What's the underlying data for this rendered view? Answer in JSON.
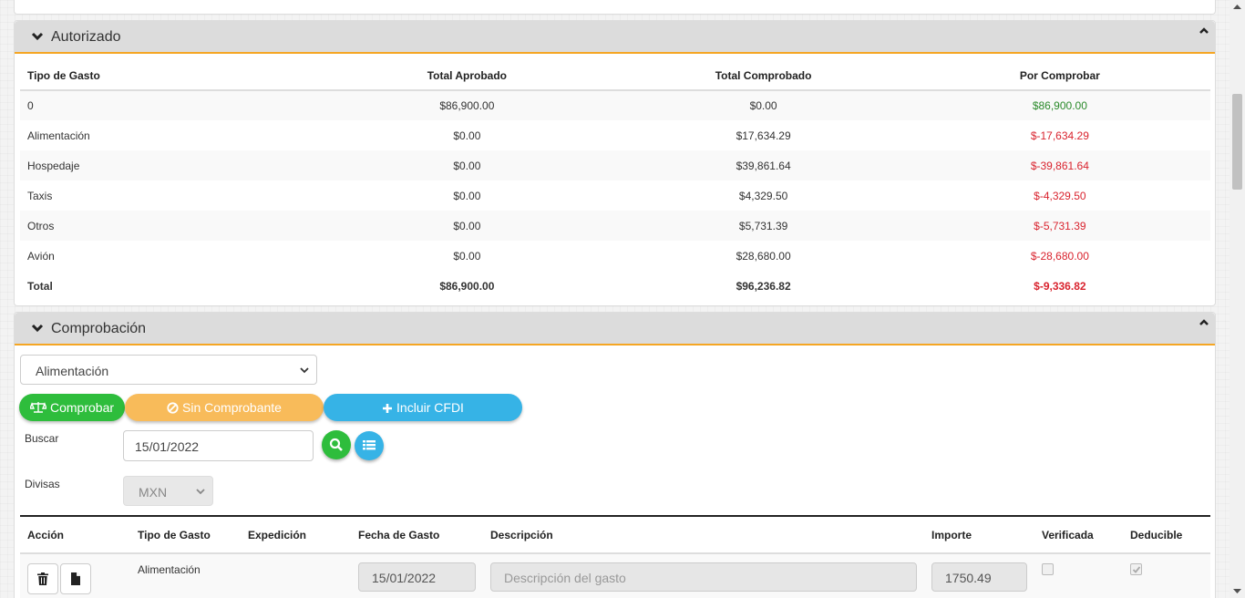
{
  "autorizado": {
    "title": "Autorizado",
    "headers": [
      "Tipo de Gasto",
      "Total Aprobado",
      "Total Comprobado",
      "Por Comprobar"
    ],
    "rows": [
      [
        "0",
        "$86,900.00",
        "$0.00",
        "$86,900.00"
      ],
      [
        "Alimentación",
        "$0.00",
        "$17,634.29",
        "$-17,634.29"
      ],
      [
        "Hospedaje",
        "$0.00",
        "$39,861.64",
        "$-39,861.64"
      ],
      [
        "Taxis",
        "$0.00",
        "$4,329.50",
        "$-4,329.50"
      ],
      [
        "Otros",
        "$0.00",
        "$5,731.39",
        "$-5,731.39"
      ],
      [
        "Avión",
        "$0.00",
        "$28,680.00",
        "$-28,680.00"
      ],
      [
        "Total",
        "$86,900.00",
        "$96,236.82",
        "$-9,336.82"
      ]
    ],
    "row_status": [
      "pos",
      "neg",
      "neg",
      "neg",
      "neg",
      "neg",
      "neg"
    ]
  },
  "comprobacion": {
    "title": "Comprobación",
    "category_select": "Alimentación",
    "btn_comprobar": "Comprobar",
    "btn_sin_comprobante": "Sin Comprobante",
    "btn_incluir_cfdi": "Incluir CFDI",
    "buscar_label": "Buscar",
    "buscar_value": "15/01/2022",
    "divisas_label": "Divisas",
    "divisas_value": "MXN",
    "table_headers": {
      "accion": "Acción",
      "tipo": "Tipo de Gasto",
      "expedicion": "Expedición",
      "fecha": "Fecha de Gasto",
      "descripcion": "Descripción",
      "importe": "Importe",
      "verificada": "Verificada",
      "deducible": "Deducible"
    },
    "row": {
      "tipo": "Alimentación",
      "fecha": "15/01/2022",
      "descripcion_placeholder": "Descripción del gasto",
      "importe": "1750.49"
    }
  },
  "colors": {
    "accent": "#f5a623",
    "green": "#2ebd3c",
    "orange": "#f8bb5a",
    "blue": "#36b3e6",
    "positive": "#2a8a2a",
    "negative": "#d9232e"
  }
}
